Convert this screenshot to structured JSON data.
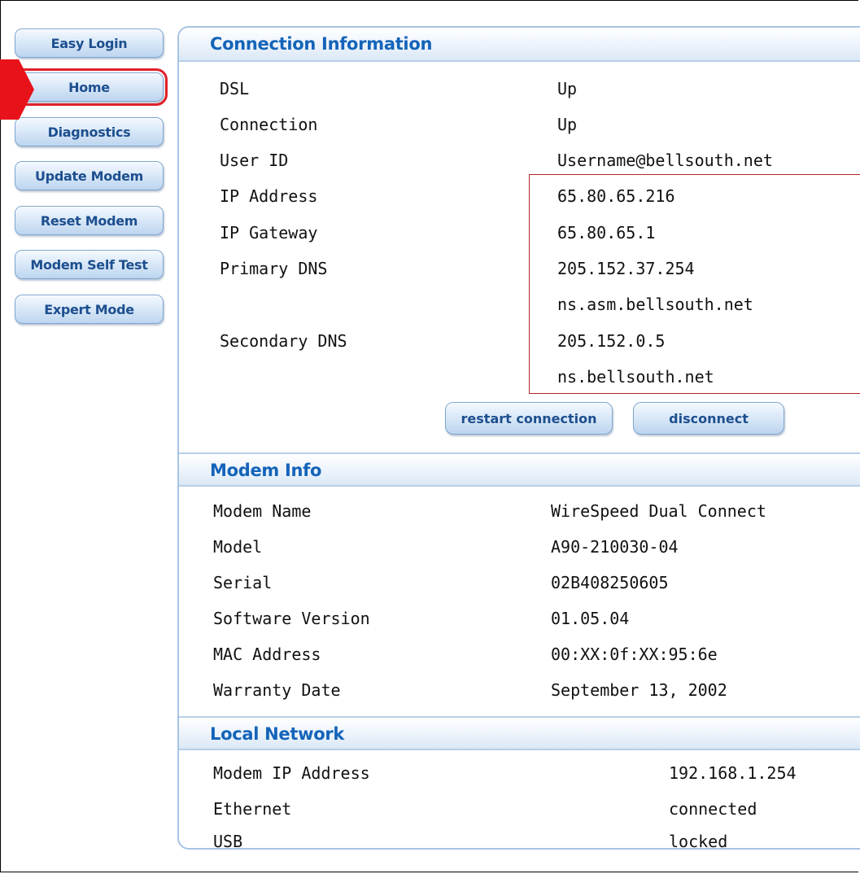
{
  "sidebar": {
    "buttons": [
      {
        "label": "Easy Login"
      },
      {
        "label": "Home"
      },
      {
        "label": "Diagnostics"
      },
      {
        "label": "Update Modem"
      },
      {
        "label": "Reset Modem"
      },
      {
        "label": "Modem Self Test"
      },
      {
        "label": "Expert Mode"
      }
    ],
    "active": "Home"
  },
  "connection": {
    "title": "Connection Information",
    "rows": [
      {
        "label": "DSL",
        "value": "Up"
      },
      {
        "label": "Connection",
        "value": "Up"
      },
      {
        "label": "User ID",
        "value": "Username@bellsouth.net"
      },
      {
        "label": "IP Address",
        "value": "65.80.65.216"
      },
      {
        "label": "IP Gateway",
        "value": "65.80.65.1"
      },
      {
        "label": "Primary DNS",
        "value": "205.152.37.254"
      },
      {
        "label": "",
        "value": "ns.asm.bellsouth.net"
      },
      {
        "label": "Secondary DNS",
        "value": "205.152.0.5"
      },
      {
        "label": "",
        "value": "ns.bellsouth.net"
      }
    ],
    "restart_label": "restart connection",
    "disconnect_label": "disconnect"
  },
  "modem_info": {
    "title": "Modem Info",
    "rows": [
      {
        "label": "Modem Name",
        "value": "WireSpeed Dual Connect"
      },
      {
        "label": "Model",
        "value": "A90-210030-04"
      },
      {
        "label": "Serial",
        "value": "02B408250605"
      },
      {
        "label": "Software Version",
        "value": "01.05.04"
      },
      {
        "label": "MAC Address",
        "value": "00:XX:0f:XX:95:6e"
      },
      {
        "label": "Warranty Date",
        "value": "September 13, 2002"
      }
    ]
  },
  "local_network": {
    "title": "Local Network",
    "rows": [
      {
        "label": "Modem IP Address",
        "value": "192.168.1.254"
      },
      {
        "label": "Ethernet",
        "value": "connected"
      },
      {
        "label": "USB",
        "value": "locked"
      }
    ]
  },
  "colors": {
    "accent": "#1464b9",
    "highlight": "#e8121a"
  }
}
